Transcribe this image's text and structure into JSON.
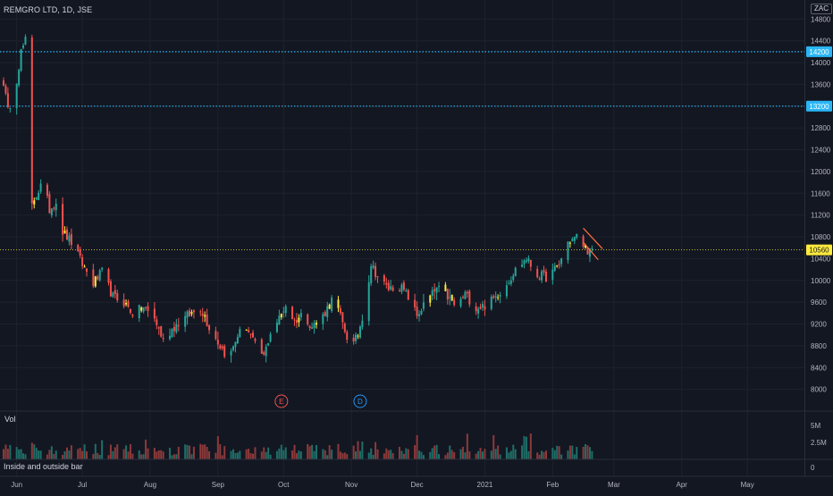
{
  "header": {
    "symbol_title": "REMGRO LTD, 1D, JSE",
    "currency": "ZAC"
  },
  "colors": {
    "background": "#131722",
    "grid": "#1e222d",
    "up": "#26a69a",
    "down": "#ef5350",
    "highlight": "#ffeb3b",
    "level_line": "#29b6f6",
    "price_tag": "#ffeb3b",
    "axis_text": "#b2b5be",
    "flag": "#ff6f3c"
  },
  "events": [
    {
      "label": "E",
      "date": "2020-09-30",
      "color": "#ef5350"
    },
    {
      "label": "D",
      "date": "2020-11-05",
      "color": "#2196f3"
    }
  ],
  "volume_panel": {
    "label": "Vol",
    "ticks": [
      "5M",
      "2.5M"
    ]
  },
  "indicator_panel": {
    "label": "Inside and outside bar",
    "zero_label": "0"
  },
  "chart_data": {
    "type": "candlestick",
    "title": "REMGRO LTD, 1D, JSE",
    "y_ticks": [
      8000,
      8400,
      8800,
      9200,
      9600,
      10000,
      10400,
      10800,
      11200,
      11600,
      12000,
      12400,
      12800,
      13200,
      13600,
      14000,
      14400,
      14800
    ],
    "ylim": [
      7600,
      15150
    ],
    "x_ticks": [
      "Jun",
      "Jul",
      "Aug",
      "Sep",
      "Oct",
      "Nov",
      "Dec",
      "2021",
      "Feb",
      "Mar",
      "Apr",
      "May"
    ],
    "x_tick_dates": [
      "2020-06-01",
      "2020-07-01",
      "2020-08-01",
      "2020-09-01",
      "2020-10-01",
      "2020-11-01",
      "2020-12-01",
      "2021-01-01",
      "2021-02-01",
      "2021-03-01",
      "2021-04-01",
      "2021-05-01"
    ],
    "xlim": [
      "2020-05-26",
      "2021-05-23"
    ],
    "date_range": [
      "2020-05-26",
      "2021-02-21"
    ],
    "horizontal_levels": [
      {
        "price": 13200,
        "label": "13200"
      },
      {
        "price": 14200,
        "label": "14200"
      }
    ],
    "last_price": {
      "value": 10560,
      "label": "10560"
    },
    "close_anchors": [
      [
        "2020-05-26",
        13650
      ],
      [
        "2020-05-28",
        13100
      ],
      [
        "2020-06-01",
        13700
      ],
      [
        "2020-06-03",
        14200
      ],
      [
        "2020-06-05",
        14400
      ],
      [
        "2020-06-06",
        11100
      ],
      [
        "2020-06-09",
        11500
      ],
      [
        "2020-06-11",
        11650
      ],
      [
        "2020-06-13",
        11800
      ],
      [
        "2020-06-16",
        11300
      ],
      [
        "2020-06-19",
        11450
      ],
      [
        "2020-06-22",
        10900
      ],
      [
        "2020-06-26",
        10700
      ],
      [
        "2020-07-01",
        10300
      ],
      [
        "2020-07-06",
        9950
      ],
      [
        "2020-07-10",
        10150
      ],
      [
        "2020-07-15",
        9700
      ],
      [
        "2020-07-20",
        9600
      ],
      [
        "2020-07-24",
        9400
      ],
      [
        "2020-07-29",
        9500
      ],
      [
        "2020-08-03",
        9300
      ],
      [
        "2020-08-07",
        8900
      ],
      [
        "2020-08-12",
        9150
      ],
      [
        "2020-08-18",
        9350
      ],
      [
        "2020-08-24",
        9500
      ],
      [
        "2020-08-28",
        9150
      ],
      [
        "2020-09-02",
        8800
      ],
      [
        "2020-09-06",
        8550
      ],
      [
        "2020-09-10",
        9000
      ],
      [
        "2020-09-14",
        9150
      ],
      [
        "2020-09-18",
        8800
      ],
      [
        "2020-09-22",
        8600
      ],
      [
        "2020-09-25",
        9050
      ],
      [
        "2020-09-29",
        9300
      ],
      [
        "2020-10-02",
        9550
      ],
      [
        "2020-10-06",
        9250
      ],
      [
        "2020-10-10",
        9400
      ],
      [
        "2020-10-14",
        9150
      ],
      [
        "2020-10-19",
        9350
      ],
      [
        "2020-10-24",
        9700
      ],
      [
        "2020-10-28",
        9200
      ],
      [
        "2020-11-01",
        8750
      ],
      [
        "2020-11-04",
        9000
      ],
      [
        "2020-11-07",
        9500
      ],
      [
        "2020-11-10",
        10300
      ],
      [
        "2020-11-14",
        10000
      ],
      [
        "2020-11-18",
        9850
      ],
      [
        "2020-11-23",
        9900
      ],
      [
        "2020-11-27",
        9700
      ],
      [
        "2020-12-01",
        9350
      ],
      [
        "2020-12-05",
        9600
      ],
      [
        "2020-12-10",
        9850
      ],
      [
        "2020-12-15",
        9700
      ],
      [
        "2020-12-19",
        9500
      ],
      [
        "2020-12-23",
        9750
      ],
      [
        "2020-12-28",
        9500
      ],
      [
        "2021-01-02",
        9550
      ],
      [
        "2021-01-06",
        9700
      ],
      [
        "2021-01-11",
        9950
      ],
      [
        "2021-01-16",
        10250
      ],
      [
        "2021-01-20",
        10400
      ],
      [
        "2021-01-25",
        10100
      ],
      [
        "2021-01-30",
        10050
      ],
      [
        "2021-02-04",
        10300
      ],
      [
        "2021-02-08",
        10700
      ],
      [
        "2021-02-12",
        10800
      ],
      [
        "2021-02-15",
        10650
      ],
      [
        "2021-02-18",
        10520
      ],
      [
        "2021-02-21",
        10560
      ]
    ],
    "volume_ylim": [
      0,
      6600000
    ],
    "volume_ticks": [
      2500000,
      5000000
    ]
  }
}
